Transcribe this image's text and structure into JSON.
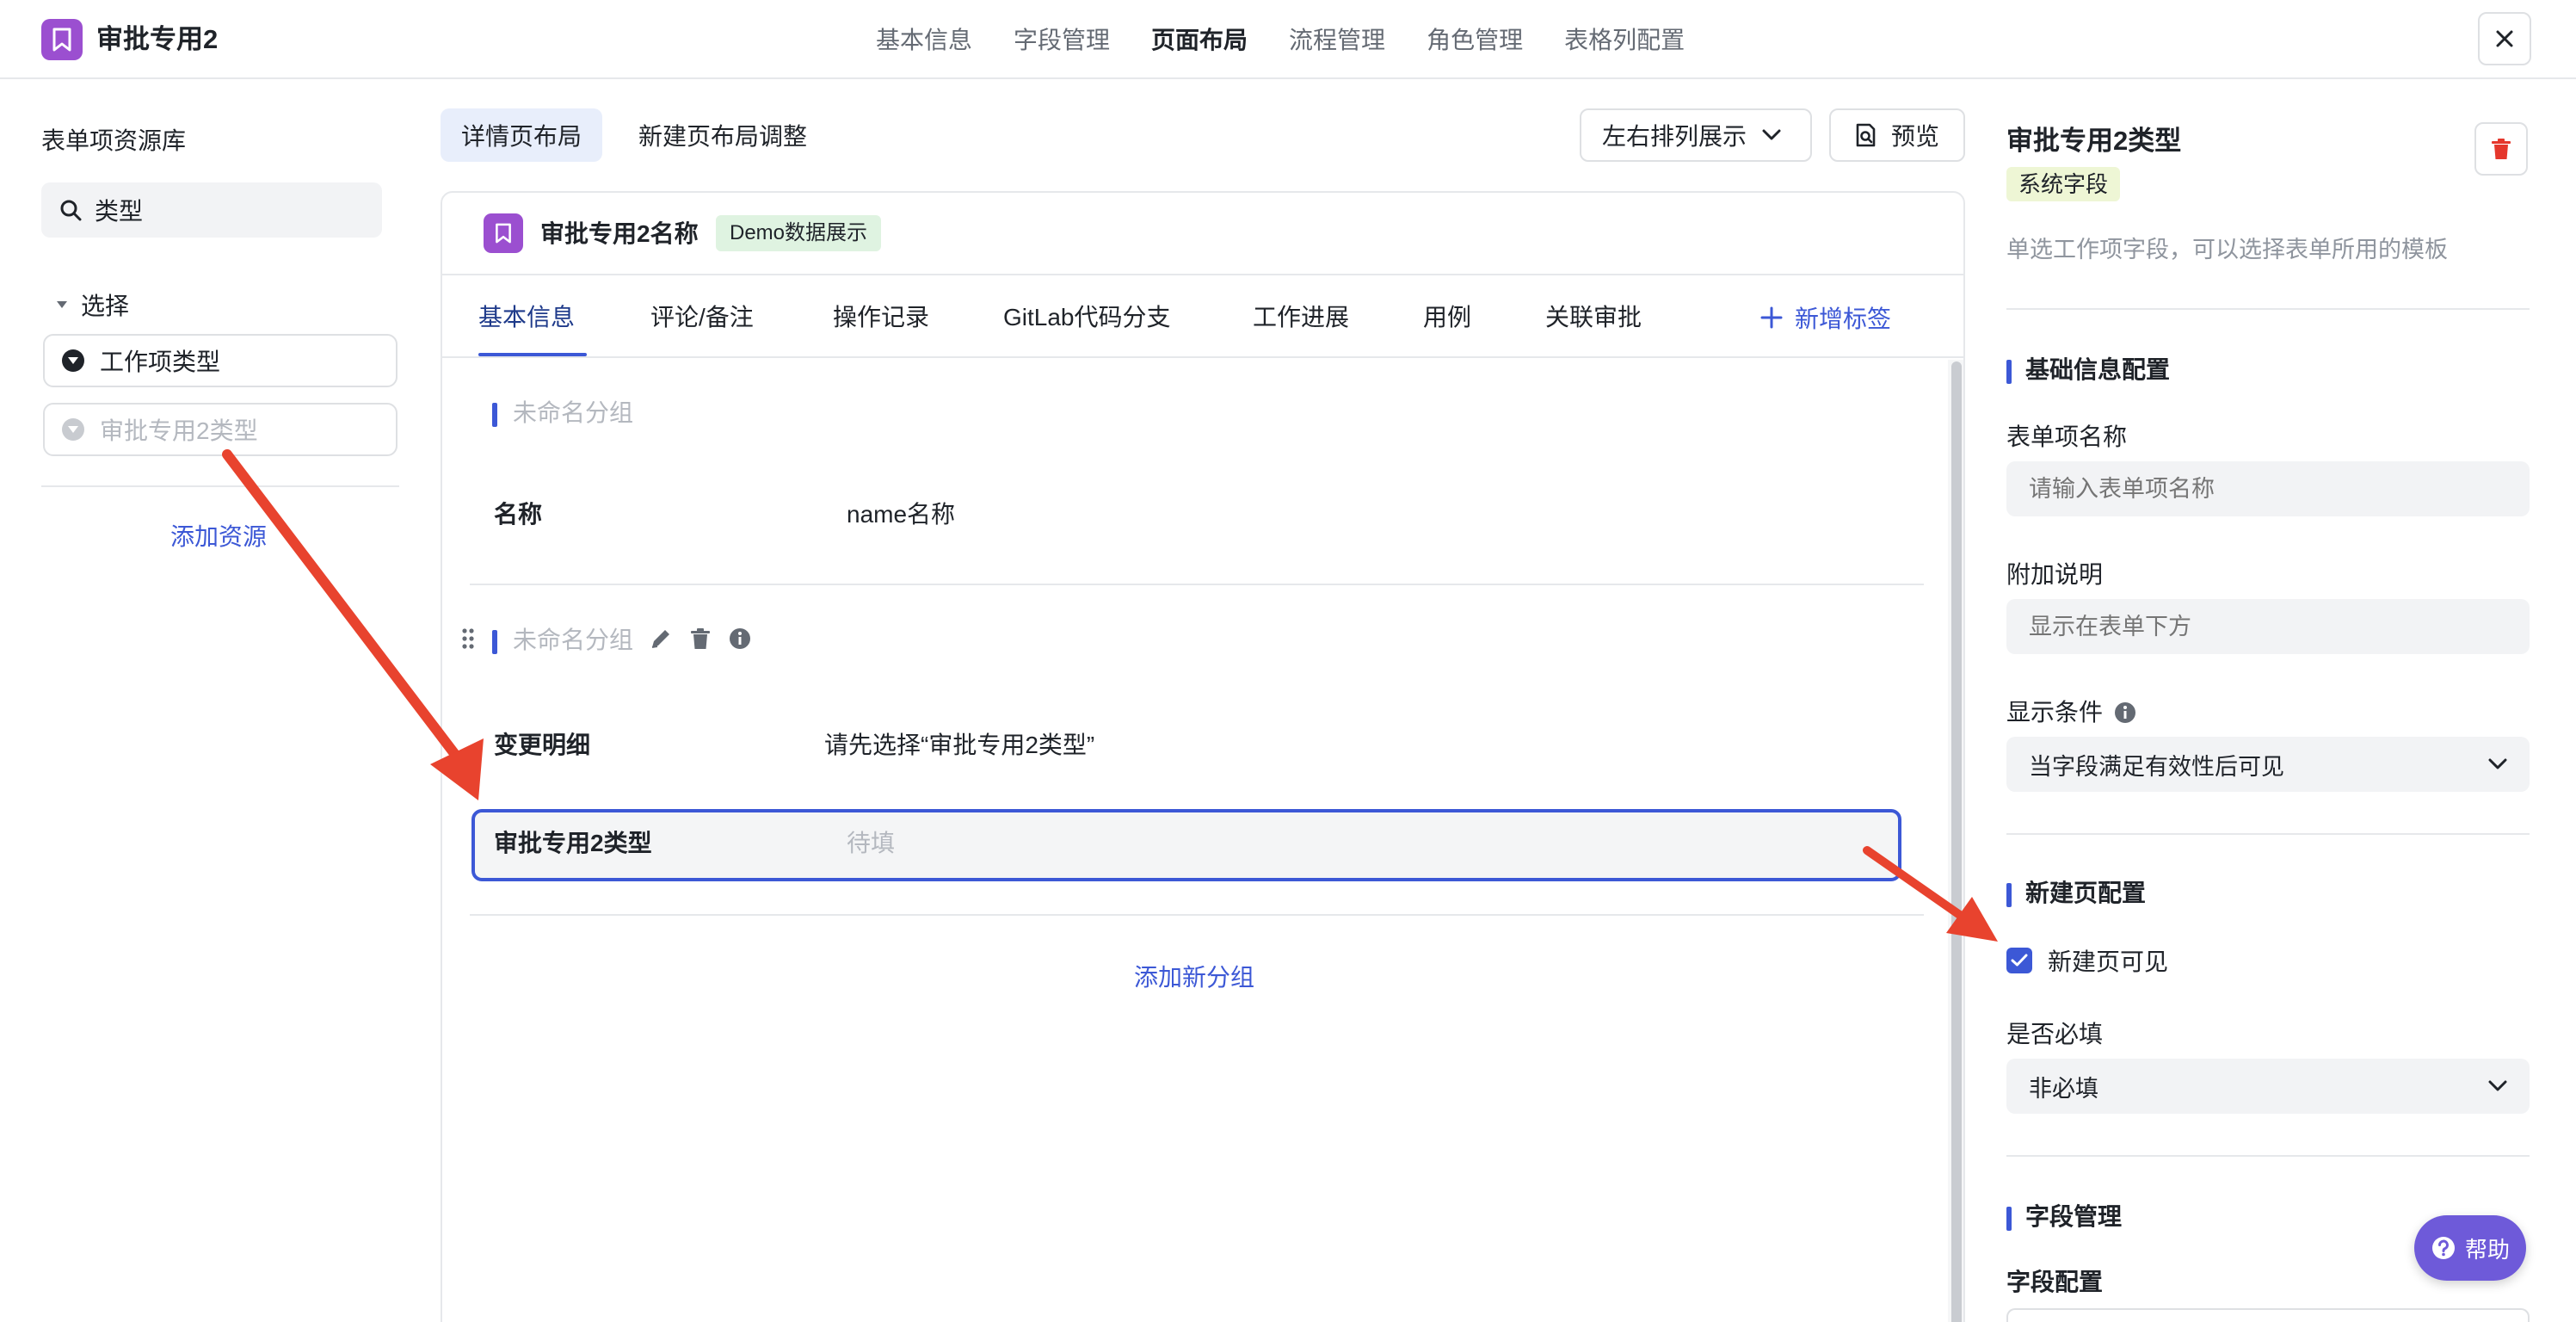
{
  "header": {
    "app_title": "审批专用2",
    "nav": [
      "基本信息",
      "字段管理",
      "页面布局",
      "流程管理",
      "角色管理",
      "表格列配置"
    ],
    "active_nav": "页面布局"
  },
  "left_panel": {
    "title": "表单项资源库",
    "search_value": "类型",
    "group_label": "选择",
    "items": [
      {
        "label": "工作项类型",
        "disabled": false
      },
      {
        "label": "审批专用2类型",
        "disabled": true
      }
    ],
    "add_resource": "添加资源"
  },
  "toolbar": {
    "tabs": [
      "详情页布局",
      "新建页布局调整"
    ],
    "arrange_label": "左右排列展示",
    "preview_label": "预览"
  },
  "card": {
    "title": "审批专用2名称",
    "badge": "Demo数据展示",
    "tabs": [
      "基本信息",
      "评论/备注",
      "操作记录",
      "GitLab代码分支",
      "工作进展",
      "用例",
      "关联审批"
    ],
    "add_tab": "新增标签",
    "groups": [
      {
        "name": "未命名分组",
        "fields": [
          {
            "label": "名称",
            "value": "name名称"
          }
        ]
      },
      {
        "name": "未命名分组",
        "fields": [
          {
            "label": "变更明细",
            "value": "请先选择“审批专用2类型”"
          },
          {
            "label": "审批专用2类型",
            "value": "待填"
          }
        ]
      }
    ],
    "add_group": "添加新分组"
  },
  "right_panel": {
    "title": "审批专用2类型",
    "badge": "系统字段",
    "description": "单选工作项字段，可以选择表单所用的模板",
    "basic_section": "基础信息配置",
    "name_label": "表单项名称",
    "name_placeholder": "请输入表单项名称",
    "note_label": "附加说明",
    "note_placeholder": "显示在表单下方",
    "condition_label": "显示条件",
    "condition_value": "当字段满足有效性后可见",
    "create_section": "新建页配置",
    "visible_label": "新建页可见",
    "required_label": "是否必填",
    "required_value": "非必填",
    "field_section": "字段管理",
    "field_config_label": "字段配置"
  },
  "help": {
    "label": "帮助"
  },
  "colors": {
    "accent": "#3c58d6",
    "brand": "#9b4fd0",
    "annotation": "#e8432e"
  }
}
